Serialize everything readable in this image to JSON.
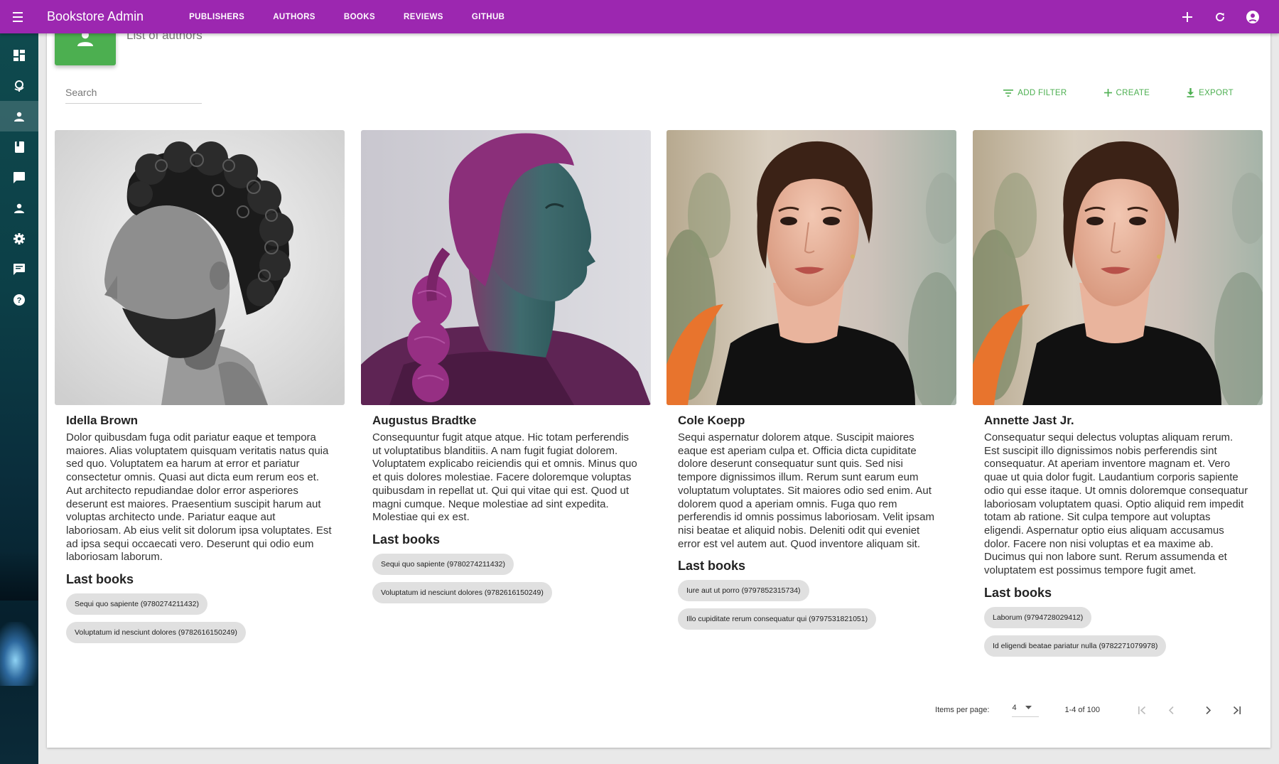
{
  "appbar": {
    "title": "Bookstore Admin",
    "nav": [
      "PUBLISHERS",
      "AUTHORS",
      "BOOKS",
      "REVIEWS",
      "GITHUB"
    ],
    "accent": "#9c27b0"
  },
  "sidebar": {
    "items": [
      {
        "icon": "dashboard-icon",
        "active": false
      },
      {
        "icon": "globe-icon",
        "active": false
      },
      {
        "icon": "person-icon",
        "active": true
      },
      {
        "icon": "book-icon",
        "active": false
      },
      {
        "icon": "comment-icon",
        "active": false
      },
      {
        "icon": "person-icon",
        "active": false
      },
      {
        "icon": "gear-icon",
        "active": false
      },
      {
        "icon": "chat-icon",
        "active": false
      },
      {
        "icon": "help-icon",
        "active": false
      }
    ]
  },
  "list": {
    "subtitle": "List of authors",
    "badge_color": "#4caf50",
    "search_placeholder": "Search",
    "toolbar": {
      "add_filter": "ADD FILTER",
      "create": "CREATE",
      "export": "EXPORT"
    },
    "last_books_label": "Last books"
  },
  "authors": [
    {
      "name": "Idella Brown",
      "photo": "bw-curly-hair-bearded-man-profile",
      "description": "Dolor quibusdam fuga odit pariatur eaque et tempora maiores. Alias voluptatem quisquam veritatis natus quia sed quo. Voluptatem ea harum at error et pariatur consectetur omnis. Quasi aut dicta eum rerum eos et. Aut architecto repudiandae dolor error asperiores deserunt est maiores. Praesentium suscipit harum aut voluptas architecto unde. Pariatur eaque aut laboriosam. Ab eius velit sit dolorum ipsa voluptates. Est ad ipsa sequi occaecati vero. Deserunt qui odio eum laboriosam laborum.",
      "books": [
        "Sequi quo sapiente (9780274211432)",
        "Voluptatum id nesciunt dolores (9782616150249)"
      ]
    },
    {
      "name": "Augustus Bradtke",
      "photo": "magenta-teal-woman-profile-braid",
      "description": "Consequuntur fugit atque atque. Hic totam perferendis ut voluptatibus blanditiis. A nam fugit fugiat dolorem. Voluptatem explicabo reiciendis qui et omnis. Minus quo et quis dolores molestiae. Facere doloremque voluptas quibusdam in repellat ut. Qui qui vitae qui est. Quod ut magni cumque. Neque molestiae ad sint expedita. Molestiae qui ex est.",
      "books": [
        "Sequi quo sapiente (9780274211432)",
        "Voluptatum id nesciunt dolores (9782616150249)"
      ]
    },
    {
      "name": "Cole Koepp",
      "photo": "woman-black-top-blurred-background",
      "description": "Sequi aspernatur dolorem atque. Suscipit maiores eaque est aperiam culpa et. Officia dicta cupiditate dolore deserunt consequatur sunt quis. Sed nisi tempore dignissimos illum. Rerum sunt earum eum voluptatum voluptates. Sit maiores odio sed enim. Aut dolorem quod a aperiam omnis. Fuga quo rem perferendis id omnis possimus laboriosam. Velit ipsam nisi beatae et aliquid nobis. Deleniti odit qui eveniet error est vel autem aut. Quod inventore aliquam sit.",
      "books": [
        "Iure aut ut porro (9797852315734)",
        "Illo cupiditate rerum consequatur qui (9797531821051)"
      ]
    },
    {
      "name": "Annette Jast Jr.",
      "photo": "woman-black-top-blurred-background",
      "description": "Consequatur sequi delectus voluptas aliquam rerum. Est suscipit illo dignissimos nobis perferendis sint consequatur. At aperiam inventore magnam et. Vero quae ut quia dolor fugit. Laudantium corporis sapiente odio qui esse itaque. Ut omnis doloremque consequatur laboriosam voluptatem quasi. Optio aliquid rem impedit totam ab ratione. Sit culpa tempore aut voluptas eligendi. Aspernatur optio eius aliquam accusamus dolor. Facere non nisi voluptas et ea maxime ab. Ducimus qui non labore sunt. Rerum assumenda et voluptatem est possimus tempore fugit amet.",
      "books": [
        "Laborum (9794728029412)",
        "Id eligendi beatae pariatur nulla (9782271079978)"
      ]
    }
  ],
  "pagination": {
    "items_per_page_label": "Items per page:",
    "per_page": "4",
    "range": "1-4 of 100"
  }
}
